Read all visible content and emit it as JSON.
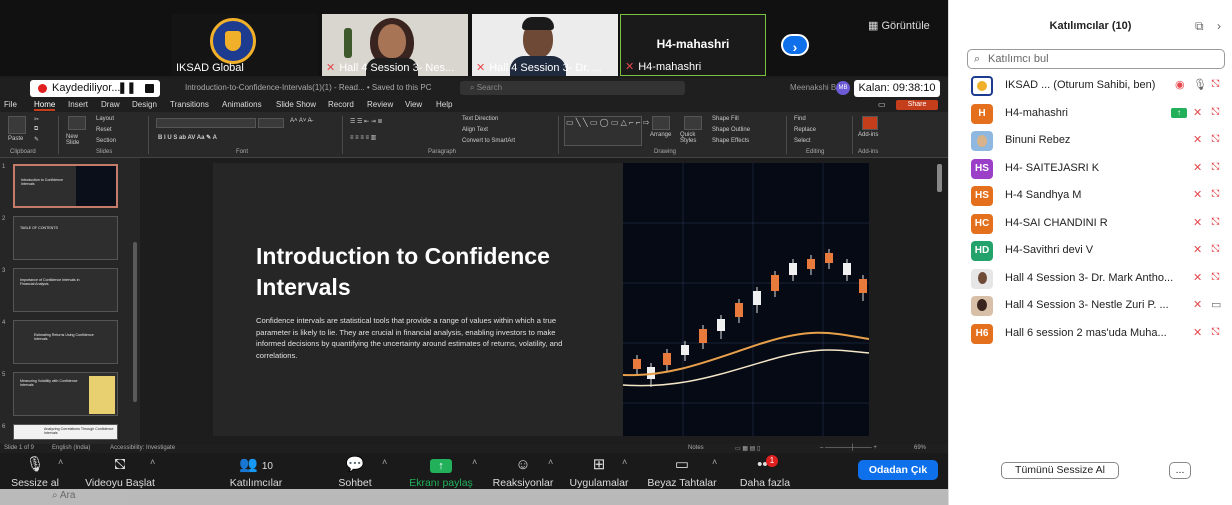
{
  "video_tiles": {
    "t1_name": "IKSAD Global",
    "t2_name": "Hall 4 Session 3- Nes...",
    "t3_name": "Hall 4 Session 3- Dr. ...",
    "t4_name": "H4-mahashri",
    "t4_center": "H4-mahashri",
    "view_label": "Görüntüle"
  },
  "ppt": {
    "recording_label": "Kaydediliyor...",
    "timer": "Kalan: 09:38:10",
    "doc_name": "Introduction-to-Confidence-Intervals(1)(1) - Read... • Saved to this PC",
    "search_placeholder": "Search",
    "user_name": "Meenakshi B",
    "avatar_initials": "MB",
    "menu": [
      "File",
      "Home",
      "Insert",
      "Draw",
      "Design",
      "Transitions",
      "Animations",
      "Slide Show",
      "Record",
      "Review",
      "View",
      "Help"
    ],
    "share": "Share",
    "ribbon_groups": [
      "Clipboard",
      "Slides",
      "Font",
      "Paragraph",
      "Drawing",
      "Editing",
      "Add-ins"
    ],
    "ribbon_labels": {
      "paste": "Paste",
      "new_slide": "New Slide",
      "layout": "Layout",
      "reset": "Reset",
      "section": "Section",
      "text_direction": "Text Direction",
      "align_text": "Align Text",
      "smartart": "Convert to SmartArt",
      "arrange": "Arrange",
      "quick_styles": "Quick Styles",
      "shape_fill": "Shape Fill",
      "shape_outline": "Shape Outline",
      "shape_effects": "Shape Effects",
      "find": "Find",
      "replace": "Replace",
      "select": "Select",
      "addins": "Add-ins"
    },
    "slide_title": "Introduction to Confidence Intervals",
    "slide_body": "Confidence intervals are statistical tools that provide a range of values within which a true parameter is likely to lie. They are crucial in financial analysis, enabling investors to make informed decisions by quantifying the uncertainty around estimates of returns, volatility, and correlations.",
    "thumbs": [
      {
        "num": "1",
        "title": "Introduction to Confidence Intervals"
      },
      {
        "num": "2",
        "title": "TABLE OF CONTENTS"
      },
      {
        "num": "3",
        "title": "Importance of Confidence Intervals in Financial Analysis"
      },
      {
        "num": "4",
        "title": "Estimating Returns Using Confidence Intervals"
      },
      {
        "num": "5",
        "title": "Measuring Volatility with Confidence Intervals"
      },
      {
        "num": "6",
        "title": "Analyzing Correlations Through Confidence Intervals"
      }
    ],
    "status": {
      "slide_of": "Slide 1 of 9",
      "language": "English (India)",
      "accessibility": "Accessibility: Investigate",
      "notes": "Notes",
      "zoom": "69%"
    }
  },
  "controls": {
    "mute": "Sessize al",
    "video": "Videoyu Başlat",
    "participants": "Katılımcılar",
    "participants_count": "10",
    "chat": "Sohbet",
    "share_screen": "Ekranı paylaş",
    "reactions": "Reaksiyonlar",
    "apps": "Uygulamalar",
    "whiteboards": "Beyaz Tahtalar",
    "more": "Daha fazla",
    "more_badge": "1",
    "leave": "Odadan Çık",
    "taskbar_search": "Ara"
  },
  "panel": {
    "title": "Katılımcılar (10)",
    "search_placeholder": "Katılımcı bul",
    "participants": [
      {
        "initials": "",
        "name": "IKSAD ... (Oturum Sahibi, ben)",
        "color": "#ffffff"
      },
      {
        "initials": "H",
        "name": "H4-mahashri",
        "color": "#e4701e"
      },
      {
        "initials": "",
        "name": "Binuni Rebez",
        "color": "#8fb8e0"
      },
      {
        "initials": "HS",
        "name": "H4- SAITEJASRI K",
        "color": "#9b3fc9"
      },
      {
        "initials": "HS",
        "name": "H-4 Sandhya M",
        "color": "#e4701e"
      },
      {
        "initials": "HC",
        "name": "H4-SAI CHANDINI R",
        "color": "#e4701e"
      },
      {
        "initials": "HD",
        "name": "H4-Savithri devi V",
        "color": "#23a36b"
      },
      {
        "initials": "",
        "name": "Hall 4 Session 3- Dr. Mark Antho...",
        "color": "#cccccc"
      },
      {
        "initials": "",
        "name": "Hall 4 Session 3- Nestle Zuri P. ...",
        "color": "#d8c0a8"
      },
      {
        "initials": "H6",
        "name": "Hall 6 session 2 mas'uda Muha...",
        "color": "#e4701e"
      }
    ],
    "mute_all": "Tümünü Sessize Al",
    "more": "..."
  }
}
